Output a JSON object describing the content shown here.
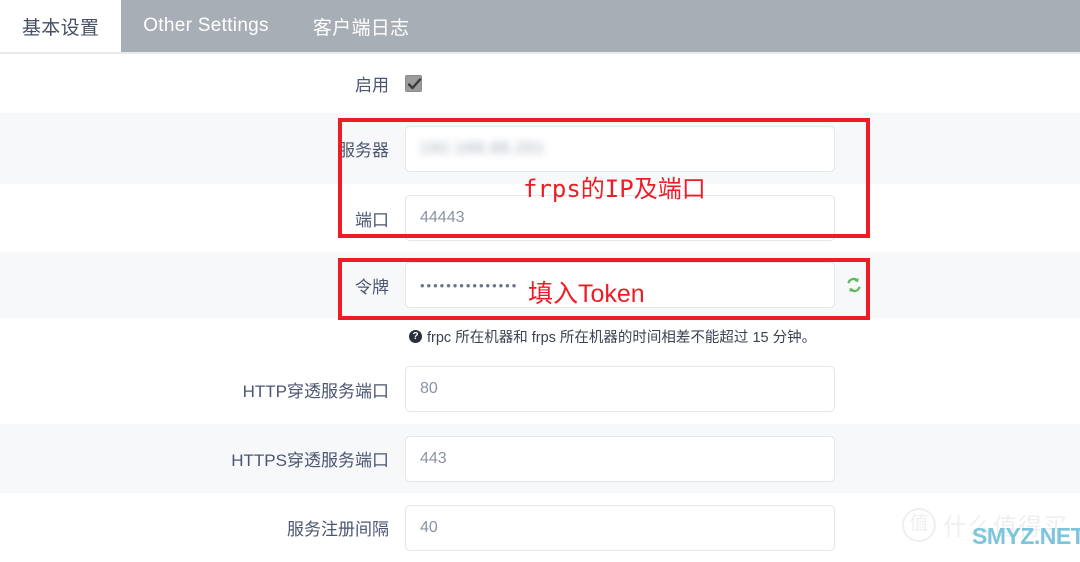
{
  "tabs": [
    {
      "label": "基本设置",
      "active": true
    },
    {
      "label": "Other Settings",
      "active": false
    },
    {
      "label": "客户端日志",
      "active": false
    }
  ],
  "form": {
    "enable": {
      "label": "启用",
      "checked": true
    },
    "fields": [
      {
        "label": "服务器",
        "value": "",
        "redacted": true
      },
      {
        "label": "端口",
        "value": "44443"
      },
      {
        "label": "令牌",
        "value": "•••••••••••••••",
        "masked": true
      },
      {
        "label": "HTTP穿透服务端口",
        "value": "80"
      },
      {
        "label": "HTTPS穿透服务端口",
        "value": "443"
      },
      {
        "label": "服务注册间隔",
        "value": "40"
      }
    ],
    "help_text": "frpc 所在机器和 frps 所在机器的时间相差不能超过 15 分钟。",
    "help_icon": "question-circle-icon",
    "token_generate_icon": "refresh-generate-icon"
  },
  "annotations": [
    {
      "text": "frps的IP及端口",
      "color": "#ee1c25"
    },
    {
      "text": "填入Token",
      "color": "#ee1c25"
    }
  ],
  "watermark": {
    "logo_char": "值",
    "cn_text": "什么值得买",
    "site": "SMYZ.NET",
    "site_color": "#7cc5dc"
  }
}
